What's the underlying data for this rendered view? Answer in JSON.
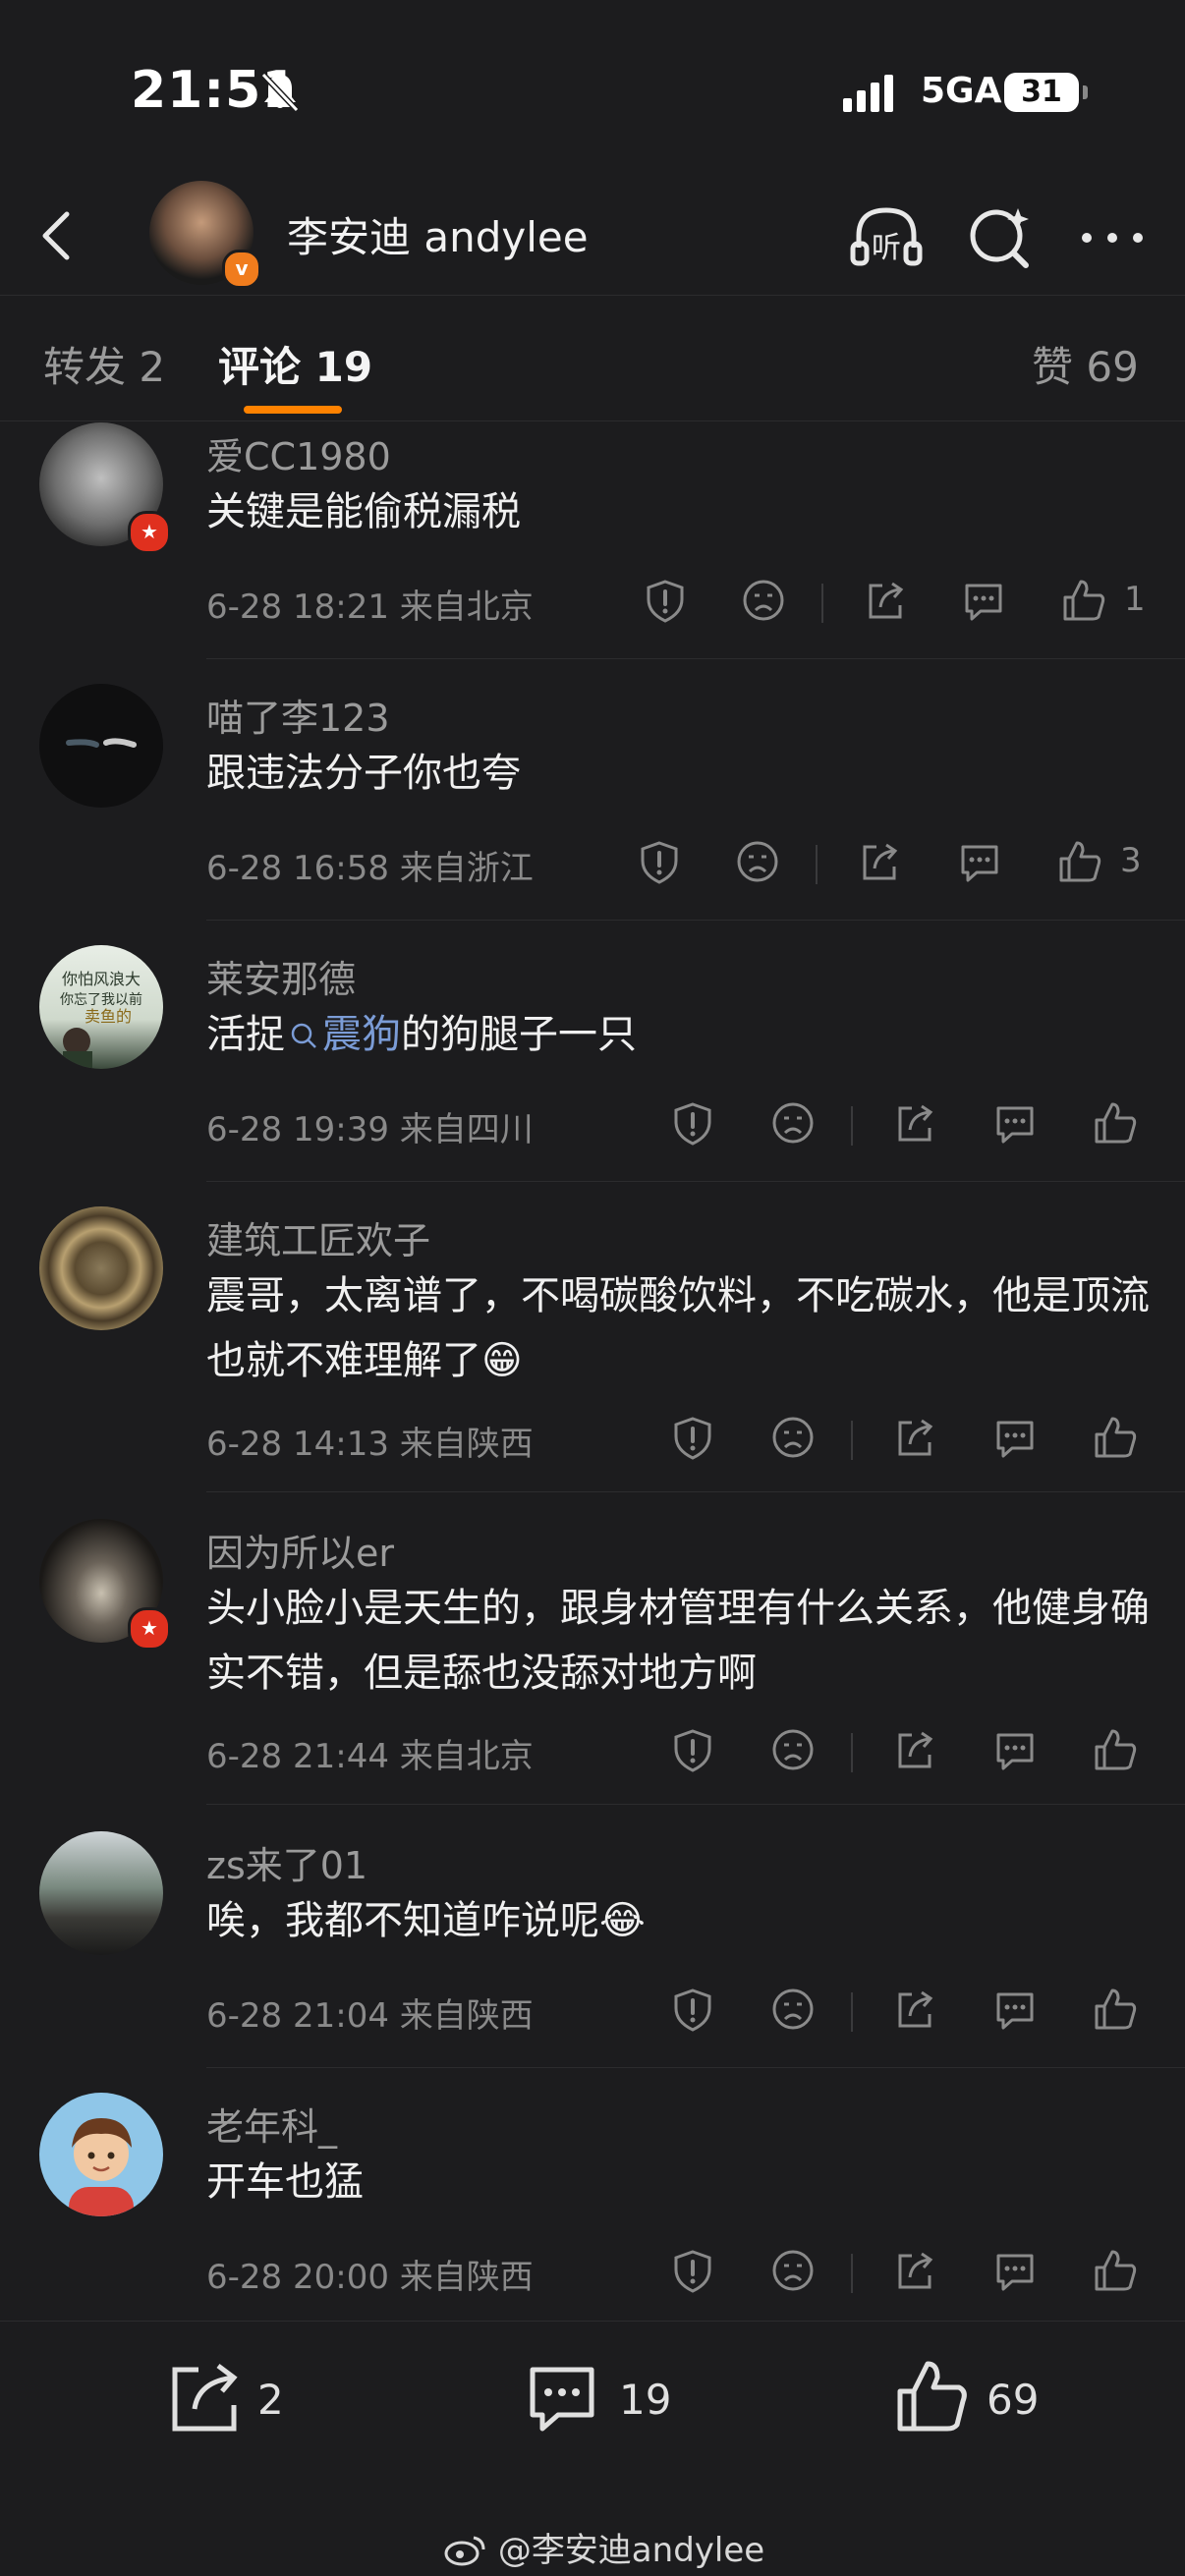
{
  "status": {
    "time": "21:51",
    "network": "5GA",
    "battery": "31"
  },
  "header": {
    "title": "李安迪 andylee",
    "badge": "v"
  },
  "tabs": [
    {
      "label": "转发 2"
    },
    {
      "label": "评论 19"
    },
    {
      "label": "赞 69"
    }
  ],
  "comments": [
    {
      "user": "爱CC1980",
      "text": "关键是能偷税漏税",
      "meta": "6-28 18:21  来自北京",
      "likes": "1"
    },
    {
      "user": "喵了李123",
      "text": "跟违法分子你也夸",
      "meta": "6-28 16:58  来自浙江",
      "likes": "3"
    },
    {
      "user": "莱安那德",
      "text_prefix": "活捉",
      "mention": "震狗",
      "text_suffix": "的狗腿子一只",
      "meta": "6-28 19:39  来自四川",
      "likes": ""
    },
    {
      "user": "建筑工匠欢子",
      "text": "震哥，太离谱了，不喝碳酸饮料，不吃碳水，他是顶流也就不难理解了😁",
      "meta": "6-28 14:13  来自陕西",
      "likes": ""
    },
    {
      "user": "因为所以er",
      "text": "头小脸小是天生的，跟身材管理有什么关系，他健身确实不错，但是舔也没舔对地方啊",
      "meta": "6-28 21:44  来自北京",
      "likes": ""
    },
    {
      "user": "zs来了01",
      "text": "唉，我都不知道咋说呢😂",
      "meta": "6-28 21:04  来自陕西",
      "likes": ""
    },
    {
      "user": "老年科_",
      "text": "开车也猛",
      "meta": "6-28 20:00  来自陕西",
      "likes": ""
    }
  ],
  "avatar_art": {
    "c3": "你怕风浪大你忘了我以前卖鱼的"
  },
  "bottom": {
    "reposts": "2",
    "comments": "19",
    "likes": "69"
  },
  "watermark": "@李安迪andylee"
}
